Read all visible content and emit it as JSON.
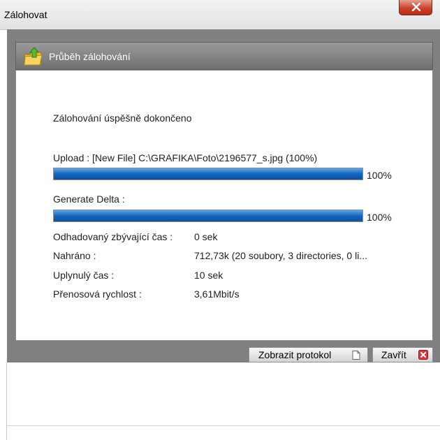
{
  "window": {
    "title": "Zálohovat"
  },
  "panel": {
    "title": "Průběh zálohování"
  },
  "status": {
    "message": "Zálohování úspěšně dokončeno"
  },
  "upload": {
    "label": "Upload :  [New File] C:\\GRAFIKA\\Foto\\2196577_s.jpg (100%)",
    "progress": 1.0,
    "percent_text": "100%"
  },
  "delta": {
    "label": "Generate Delta :",
    "progress": 1.0,
    "percent_text": "100%"
  },
  "stats": [
    {
      "label": "Odhadovaný zbývající čas :",
      "value": "0 sek"
    },
    {
      "label": "Nahráno :",
      "value": "712,73k (20 soubory, 3 directories, 0 li..."
    },
    {
      "label": "Uplynulý čas :",
      "value": "10 sek"
    },
    {
      "label": "Přenosová rychlost :",
      "value": "3,61Mbit/s"
    }
  ],
  "buttons": {
    "show_log": "Zobrazit protokol",
    "close": "Zavřít"
  },
  "colors": {
    "progress_fill": "#1565c0",
    "close_accent": "#d9363e",
    "folder_icon": "#f2c94c",
    "arrow_icon": "#5cb832"
  },
  "icons": {
    "window_close": "close-icon",
    "header": "folder-upload-icon",
    "show_log": "document-icon",
    "close_button": "red-x-icon"
  }
}
